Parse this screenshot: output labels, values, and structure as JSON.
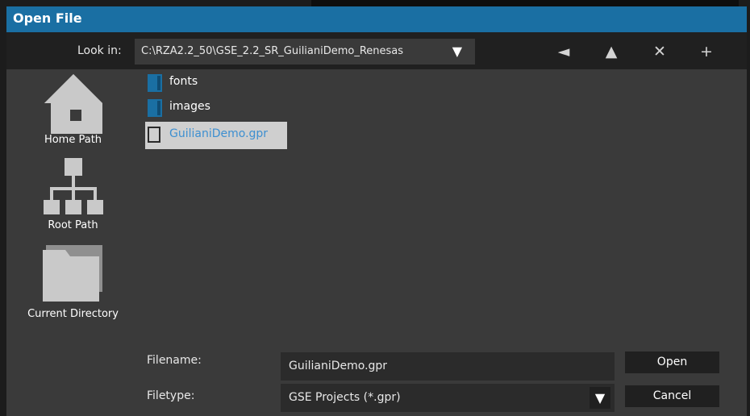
{
  "dialog": {
    "title": "Open File",
    "look_in_label": "Look in:",
    "current_path": "C:\\RZA2.2_50\\GSE_2.2_SR_GuilianiDemo_Renesas",
    "nav": {
      "back": "◄",
      "up": "▲",
      "delete": "✕",
      "new_folder": "+"
    },
    "shortcuts": [
      {
        "label": "Home Path",
        "icon": "home-icon"
      },
      {
        "label": "Root Path",
        "icon": "hierarchy-icon"
      },
      {
        "label": "Current Directory",
        "icon": "folder-icon"
      }
    ],
    "files": [
      {
        "name": "fonts",
        "type": "folder",
        "icon_color": "#1a6fa3"
      },
      {
        "name": "images",
        "type": "folder",
        "icon_color": "#1a6fa3"
      },
      {
        "name": "GuilianiDemo.gpr",
        "type": "file",
        "selected": true
      }
    ],
    "filename_label": "Filename:",
    "filename_value": "GuilianiDemo.gpr",
    "filetype_label": "Filetype:",
    "filetype_value": "GSE Projects (*.gpr)",
    "open_label": "Open",
    "cancel_label": "Cancel"
  },
  "colors": {
    "titlebar": "#1a6fa3",
    "body": "#3a3a3a",
    "toolbar": "#202020",
    "selection": "#cfcfcf",
    "selected_text": "#3d8fd0"
  }
}
